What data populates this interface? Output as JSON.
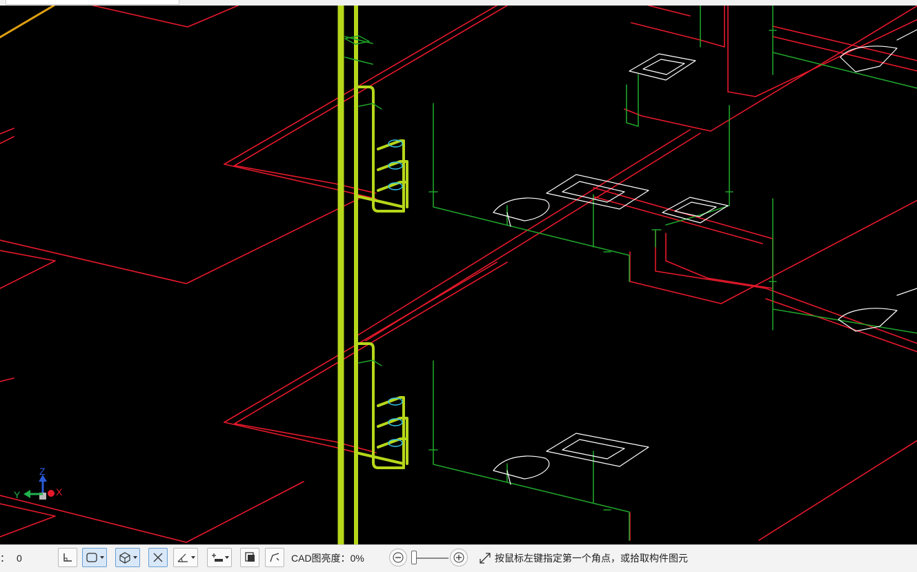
{
  "statusbar": {
    "left_label": "：",
    "left_value": "0",
    "cad_brightness_label": "CAD图亮度：",
    "cad_brightness_value": "0%",
    "prompt": "按鼠标左键指定第一个角点，或拾取构件图元"
  },
  "brightness_percent": 0,
  "axis_gizmo": {
    "x_label": "X",
    "y_label": "Y",
    "z_label": "Z"
  },
  "toolbar_icons": [
    "orthogonal-icon",
    "view-box-icon",
    "3d-cube-icon",
    "close-view-icon",
    "angle-icon",
    "add-dimension-icon",
    "display-icon",
    "polyline-icon"
  ],
  "colors": {
    "canvas": "#000000",
    "drain_pipe": "#e8192c",
    "water_pipe": "#1fa32a",
    "riser": "#b6d71a",
    "fixture": "#ffffff",
    "cyan_fixture": "#33c4e8",
    "axis_x": "#e8192c",
    "axis_y": "#22b14c",
    "axis_z": "#2a5bd7"
  }
}
